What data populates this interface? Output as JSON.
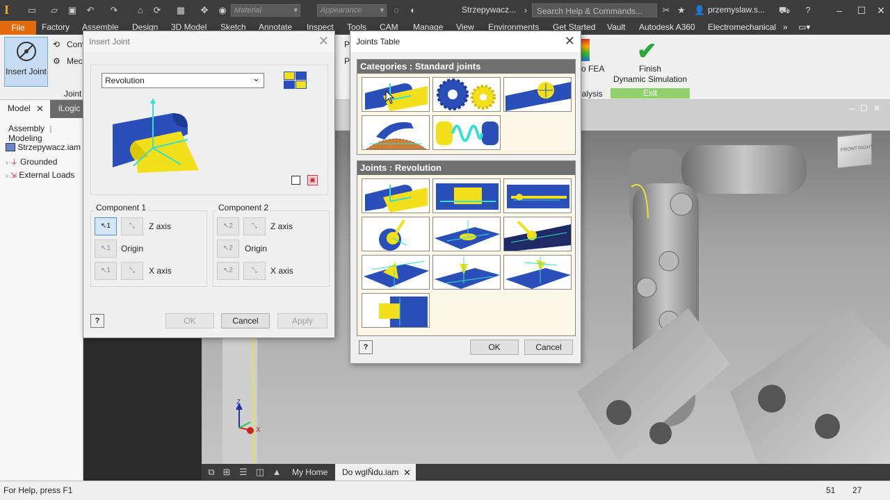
{
  "titlebar": {
    "material_placeholder": "Material",
    "appearance_placeholder": "Appearance",
    "doc_title": "Strzepywacz...",
    "search_placeholder": "Search Help & Commands...",
    "user": "przemyslaw.s..."
  },
  "menu": {
    "file": "File",
    "tabs": [
      "Factory",
      "Assemble",
      "Design",
      "3D Model",
      "Sketch",
      "Annotate",
      "Inspect",
      "Tools",
      "CAM",
      "Manage",
      "View",
      "Environments",
      "Get Started",
      "Vault",
      "Autodesk A360",
      "Electromechanical"
    ]
  },
  "ribbon": {
    "insert_joint": "Insert Joint",
    "conv": "Conv",
    "mec": "Mec",
    "joint_panel": "Joint",
    "p1": "P",
    "p2": "P",
    "fea": "o FEA",
    "analysis": "nalysis",
    "finish_line1": "Finish",
    "finish_line2": "Dynamic Simulation",
    "exit": "Exit"
  },
  "browser": {
    "tab_model": "Model",
    "tab_ilogic": "iLogic",
    "sub_assembly": "Assembly",
    "sub_modeling": "Modeling",
    "root": "Strzepywacz.iam (S",
    "grounded": "Grounded",
    "external_loads": "External Loads"
  },
  "insert_joint_dialog": {
    "title": "Insert Joint",
    "joint_type": "Revolution",
    "component1": "Component 1",
    "component2": "Component 2",
    "z_axis": "Z axis",
    "origin": "Origin",
    "x_axis": "X axis",
    "num1": "1",
    "num2": "2",
    "help": "?",
    "ok": "OK",
    "cancel": "Cancel",
    "apply": "Apply"
  },
  "joints_table": {
    "title": "Joints Table",
    "categories_header": "Categories : Standard joints",
    "joints_header": "Joints : Revolution",
    "help": "?",
    "ok": "OK",
    "cancel": "Cancel"
  },
  "viewcube": {
    "front": "FRONT",
    "right": "RIGHT"
  },
  "triad": {
    "z": "Z",
    "x": "X"
  },
  "doctabs": {
    "home": "My Home",
    "active": "Do wglŇdu.iam"
  },
  "status": {
    "text": "For Help, press F1",
    "num1": "51",
    "num2": "27"
  },
  "colors": {
    "file_tab": "#e06a0c",
    "exit_bar": "#8fd16a",
    "finish_check": "#2aa83a",
    "joint_blue": "#2a4fb8",
    "joint_yellow": "#f2e01a",
    "axis_cyan": "#33e0d0"
  }
}
